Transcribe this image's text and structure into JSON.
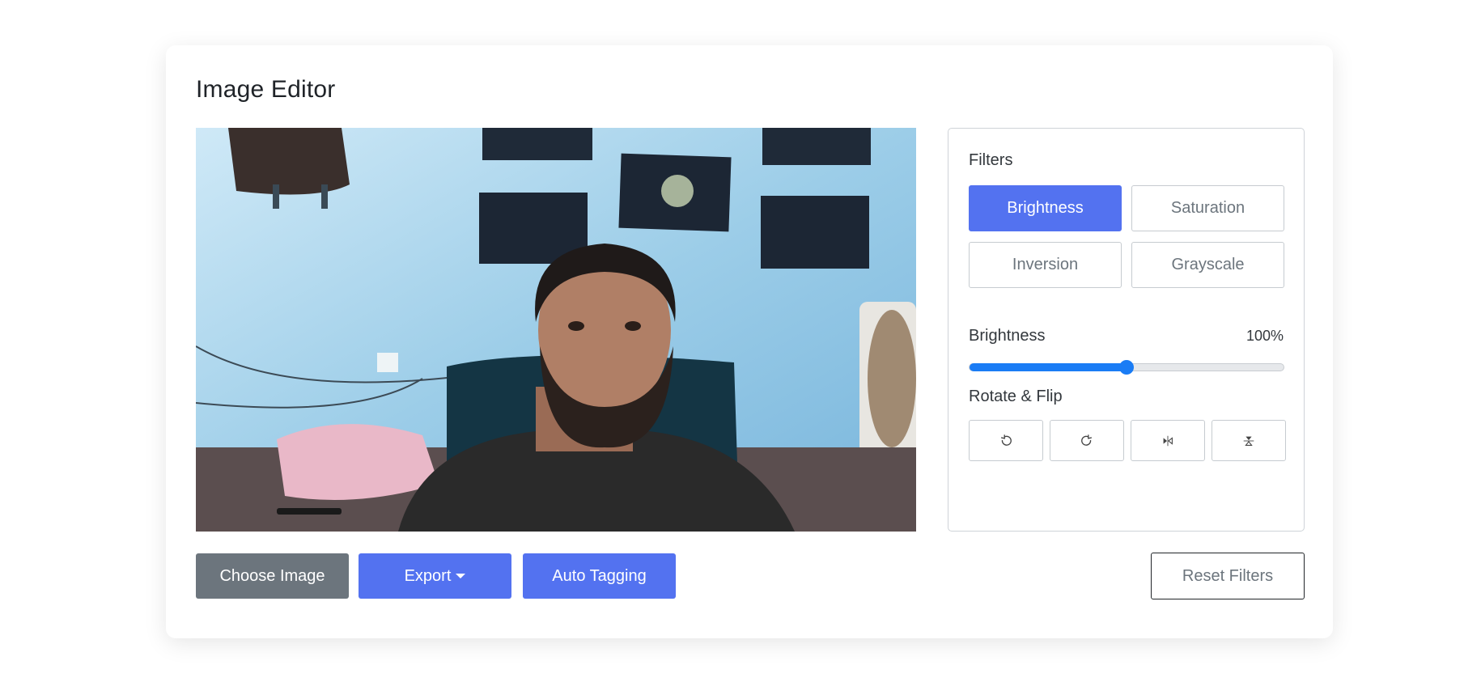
{
  "app": {
    "title": "Image Editor"
  },
  "preview": {
    "image_alt": "Uploaded photo preview"
  },
  "filters": {
    "heading": "Filters",
    "buttons": [
      {
        "label": "Brightness",
        "active": true
      },
      {
        "label": "Saturation",
        "active": false
      },
      {
        "label": "Inversion",
        "active": false
      },
      {
        "label": "Grayscale",
        "active": false
      }
    ]
  },
  "slider": {
    "name": "Brightness",
    "value_text": "100%",
    "level_fraction": 0.5
  },
  "rotate": {
    "heading": "Rotate & Flip",
    "buttons": [
      {
        "icon": "rotate-left-icon"
      },
      {
        "icon": "rotate-right-icon"
      },
      {
        "icon": "flip-horizontal-icon"
      },
      {
        "icon": "flip-vertical-icon"
      }
    ]
  },
  "actions": {
    "choose_label": "Choose Image",
    "export_label": "Export",
    "auto_tag_label": "Auto Tagging",
    "reset_label": "Reset Filters"
  },
  "colors": {
    "accent": "#5372f0",
    "secondary": "#6c757d",
    "slider": "#1a7cf5"
  }
}
